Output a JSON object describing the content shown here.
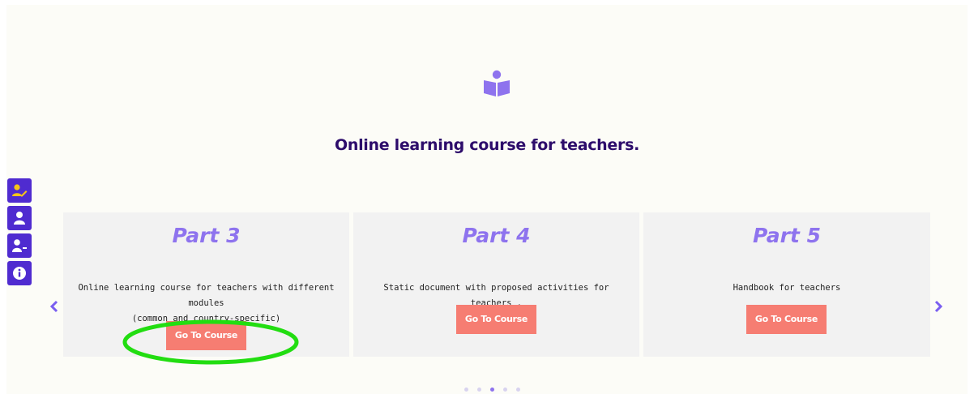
{
  "hero": {
    "icon": "reading-person-icon",
    "title": "Online learning course for teachers."
  },
  "side_toolbar": {
    "buttons": [
      {
        "icon": "user-edit-icon",
        "color": "#f5c518"
      },
      {
        "icon": "user-icon",
        "color": "#ffffff"
      },
      {
        "icon": "user-minus-icon",
        "color": "#ffffff"
      },
      {
        "icon": "info-icon",
        "color": "#ffffff"
      }
    ],
    "background": "#4f2bd0"
  },
  "carousel": {
    "prev_icon": "chevron-left-icon",
    "next_icon": "chevron-right-icon",
    "cards": [
      {
        "title": "Part 3",
        "description_lines": [
          "Online learning course for teachers with different modules",
          "(common and country-specific)"
        ],
        "button_label": "Go To Course"
      },
      {
        "title": "Part 4",
        "description_lines": [
          "Static document with proposed activities for teachers ."
        ],
        "button_label": "Go To Course"
      },
      {
        "title": "Part 5",
        "description_lines": [
          "Handbook for teachers"
        ],
        "button_label": "Go To Course"
      }
    ],
    "pager": {
      "total": 5,
      "active_index": 2
    }
  },
  "colors": {
    "accent": "#8e73ee",
    "title": "#2d0c6b",
    "button": "#f67d72",
    "highlight": "#22dd11"
  }
}
